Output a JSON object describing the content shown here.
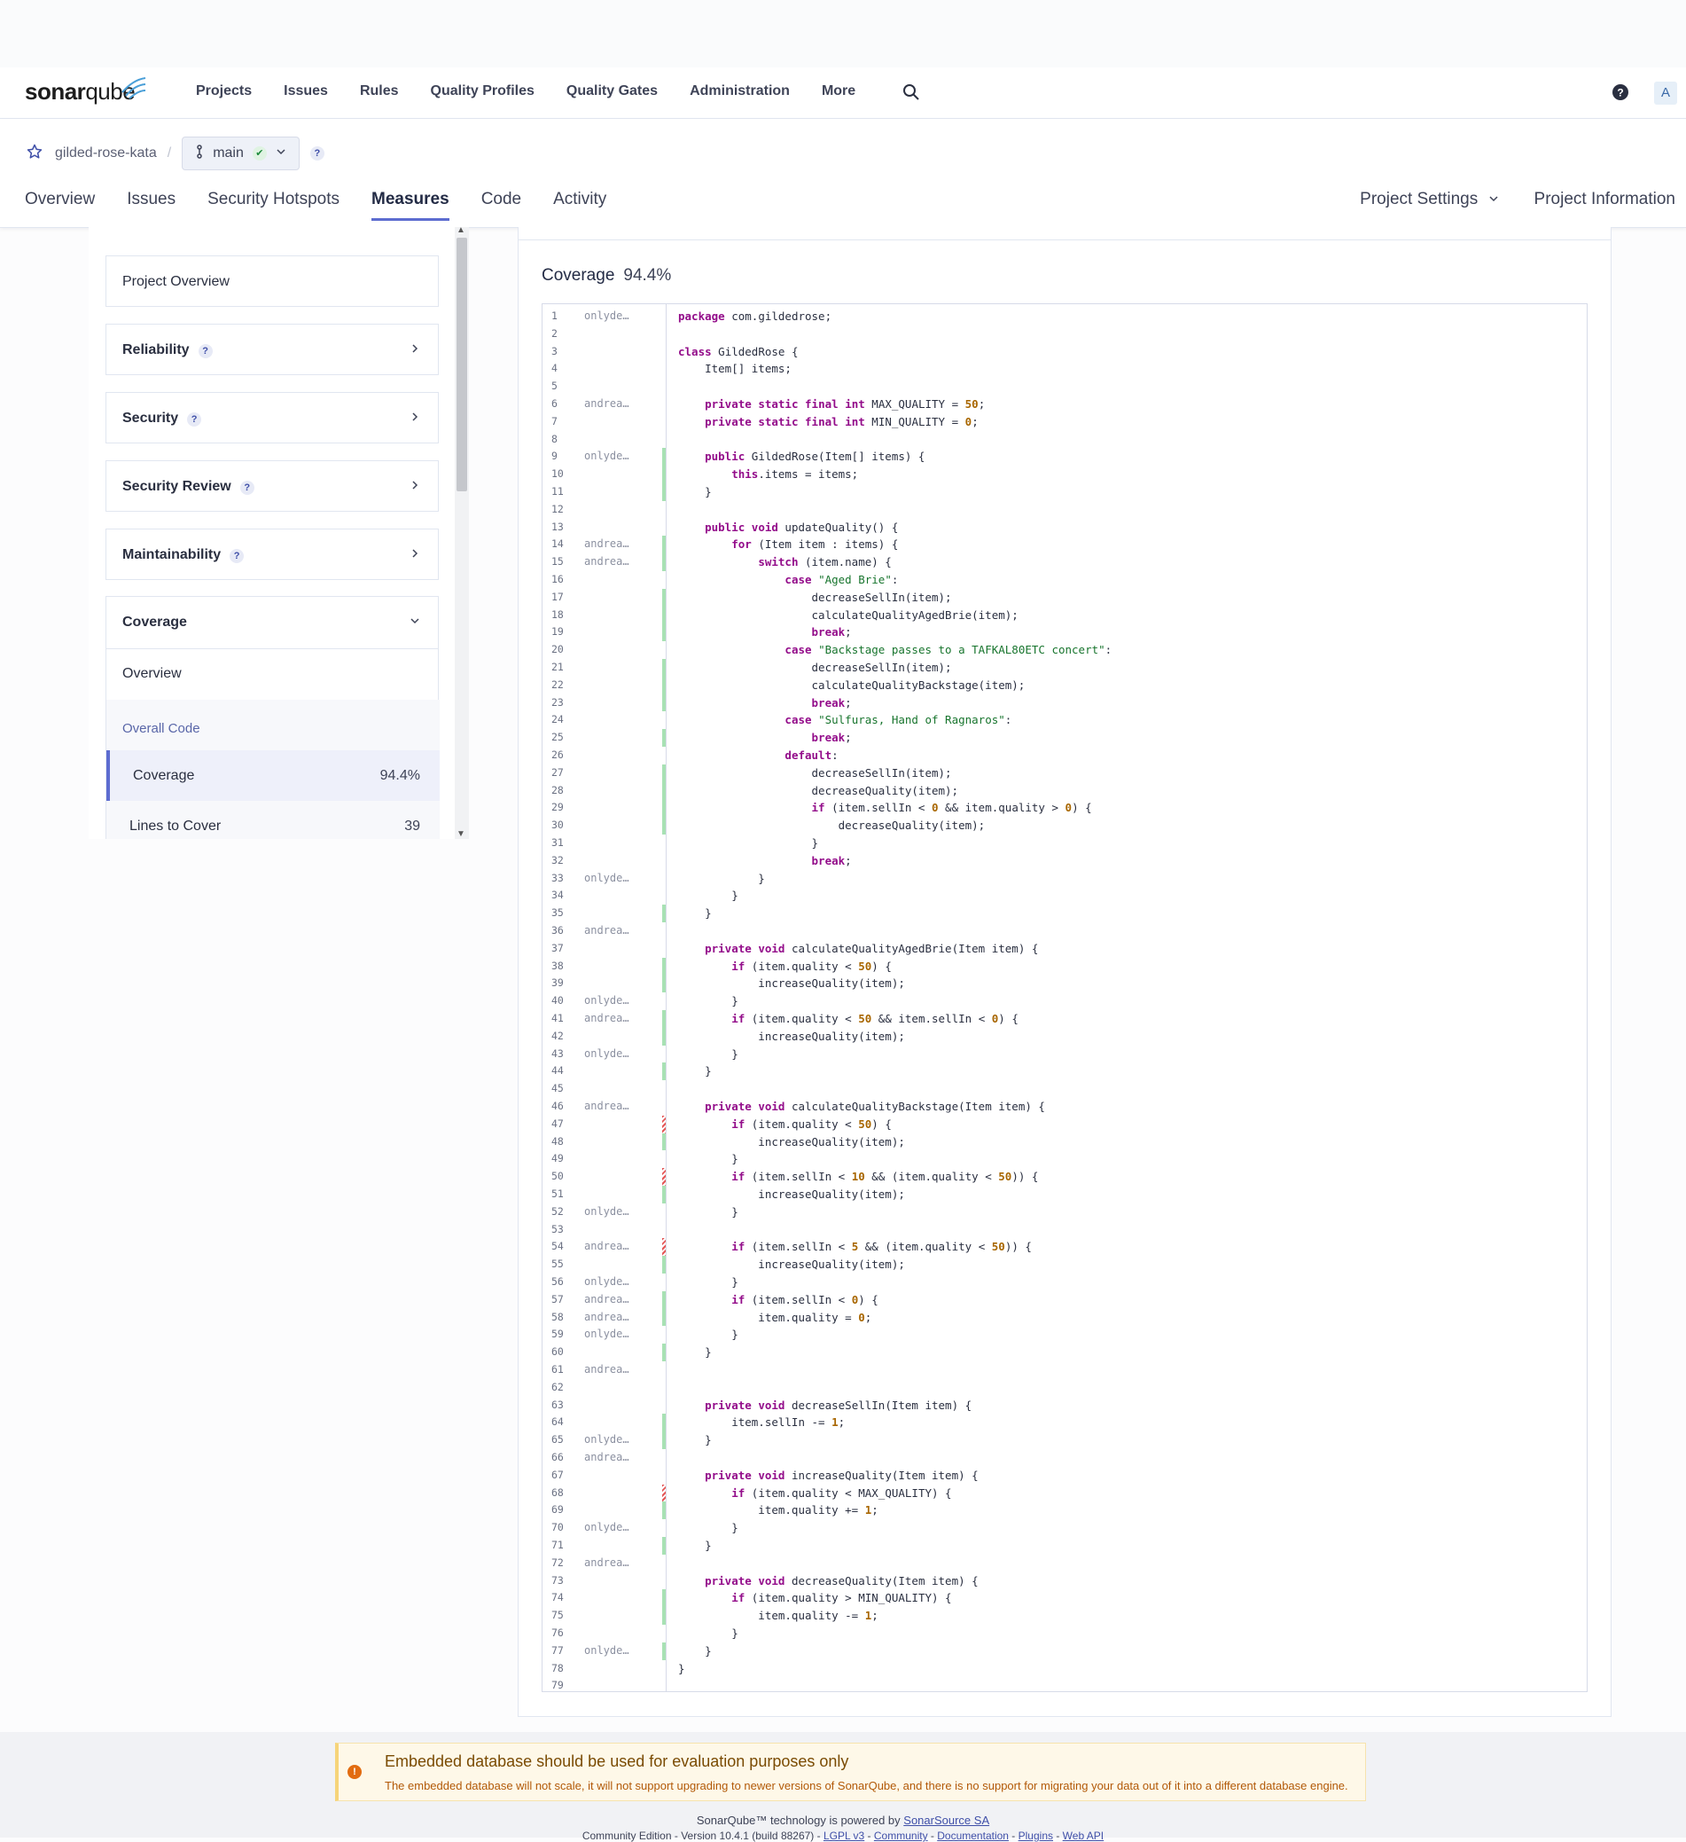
{
  "nav": {
    "logo_bold": "sonar",
    "logo_light": "qube",
    "links": [
      "Projects",
      "Issues",
      "Rules",
      "Quality Profiles",
      "Quality Gates",
      "Administration",
      "More"
    ],
    "avatar": "A"
  },
  "project": {
    "name": "gilded-rose-kata",
    "branch": "main",
    "tabs": [
      "Overview",
      "Issues",
      "Security Hotspots",
      "Measures",
      "Code",
      "Activity"
    ],
    "active_tab": "Measures",
    "settings": "Project Settings",
    "information": "Project Information"
  },
  "sidebar": {
    "project_overview": "Project Overview",
    "categories": [
      "Reliability",
      "Security",
      "Security Review",
      "Maintainability"
    ],
    "coverage": {
      "title": "Coverage",
      "overview": "Overview",
      "section": "Overall Code",
      "rows": [
        {
          "label": "Coverage",
          "value": "94.4%"
        },
        {
          "label": "Lines to Cover",
          "value": "39"
        }
      ]
    }
  },
  "main": {
    "title": "Coverage",
    "value": "94.4%"
  },
  "code": [
    {
      "n": 1,
      "a": "onlyde…",
      "c": "",
      "t": "package com.gildedrose;"
    },
    {
      "n": 2,
      "a": "",
      "c": "",
      "t": ""
    },
    {
      "n": 3,
      "a": "",
      "c": "",
      "t": "class GildedRose {"
    },
    {
      "n": 4,
      "a": "",
      "c": "",
      "t": "    Item[] items;"
    },
    {
      "n": 5,
      "a": "",
      "c": "",
      "t": ""
    },
    {
      "n": 6,
      "a": "andrea…",
      "c": "",
      "t": "    private static final int MAX_QUALITY = 50;"
    },
    {
      "n": 7,
      "a": "",
      "c": "",
      "t": "    private static final int MIN_QUALITY = 0;"
    },
    {
      "n": 8,
      "a": "",
      "c": "",
      "t": ""
    },
    {
      "n": 9,
      "a": "onlyde…",
      "c": "g",
      "t": "    public GildedRose(Item[] items) {"
    },
    {
      "n": 10,
      "a": "",
      "c": "g",
      "t": "        this.items = items;"
    },
    {
      "n": 11,
      "a": "",
      "c": "g",
      "t": "    }"
    },
    {
      "n": 12,
      "a": "",
      "c": "",
      "t": ""
    },
    {
      "n": 13,
      "a": "",
      "c": "",
      "t": "    public void updateQuality() {"
    },
    {
      "n": 14,
      "a": "andrea…",
      "c": "g",
      "t": "        for (Item item : items) {"
    },
    {
      "n": 15,
      "a": "andrea…",
      "c": "g",
      "t": "            switch (item.name) {"
    },
    {
      "n": 16,
      "a": "",
      "c": "",
      "t": "                case \"Aged Brie\":"
    },
    {
      "n": 17,
      "a": "",
      "c": "g",
      "t": "                    decreaseSellIn(item);"
    },
    {
      "n": 18,
      "a": "",
      "c": "g",
      "t": "                    calculateQualityAgedBrie(item);"
    },
    {
      "n": 19,
      "a": "",
      "c": "g",
      "t": "                    break;"
    },
    {
      "n": 20,
      "a": "",
      "c": "",
      "t": "                case \"Backstage passes to a TAFKAL80ETC concert\":"
    },
    {
      "n": 21,
      "a": "",
      "c": "g",
      "t": "                    decreaseSellIn(item);"
    },
    {
      "n": 22,
      "a": "",
      "c": "g",
      "t": "                    calculateQualityBackstage(item);"
    },
    {
      "n": 23,
      "a": "",
      "c": "g",
      "t": "                    break;"
    },
    {
      "n": 24,
      "a": "",
      "c": "",
      "t": "                case \"Sulfuras, Hand of Ragnaros\":"
    },
    {
      "n": 25,
      "a": "",
      "c": "g",
      "t": "                    break;"
    },
    {
      "n": 26,
      "a": "",
      "c": "",
      "t": "                default:"
    },
    {
      "n": 27,
      "a": "",
      "c": "g",
      "t": "                    decreaseSellIn(item);"
    },
    {
      "n": 28,
      "a": "",
      "c": "g",
      "t": "                    decreaseQuality(item);"
    },
    {
      "n": 29,
      "a": "",
      "c": "g",
      "t": "                    if (item.sellIn < 0 && item.quality > 0) {"
    },
    {
      "n": 30,
      "a": "",
      "c": "g",
      "t": "                        decreaseQuality(item);"
    },
    {
      "n": 31,
      "a": "",
      "c": "",
      "t": "                    }"
    },
    {
      "n": 32,
      "a": "",
      "c": "",
      "t": "                    break;"
    },
    {
      "n": 33,
      "a": "onlyde…",
      "c": "",
      "t": "            }"
    },
    {
      "n": 34,
      "a": "",
      "c": "",
      "t": "        }"
    },
    {
      "n": 35,
      "a": "",
      "c": "g",
      "t": "    }"
    },
    {
      "n": 36,
      "a": "andrea…",
      "c": "",
      "t": ""
    },
    {
      "n": 37,
      "a": "",
      "c": "",
      "t": "    private void calculateQualityAgedBrie(Item item) {"
    },
    {
      "n": 38,
      "a": "",
      "c": "g",
      "t": "        if (item.quality < 50) {"
    },
    {
      "n": 39,
      "a": "",
      "c": "g",
      "t": "            increaseQuality(item);"
    },
    {
      "n": 40,
      "a": "onlyde…",
      "c": "",
      "t": "        }"
    },
    {
      "n": 41,
      "a": "andrea…",
      "c": "g",
      "t": "        if (item.quality < 50 && item.sellIn < 0) {"
    },
    {
      "n": 42,
      "a": "",
      "c": "g",
      "t": "            increaseQuality(item);"
    },
    {
      "n": 43,
      "a": "onlyde…",
      "c": "",
      "t": "        }"
    },
    {
      "n": 44,
      "a": "",
      "c": "g",
      "t": "    }"
    },
    {
      "n": 45,
      "a": "",
      "c": "",
      "t": ""
    },
    {
      "n": 46,
      "a": "andrea…",
      "c": "",
      "t": "    private void calculateQualityBackstage(Item item) {"
    },
    {
      "n": 47,
      "a": "",
      "c": "p",
      "t": "        if (item.quality < 50) {"
    },
    {
      "n": 48,
      "a": "",
      "c": "g",
      "t": "            increaseQuality(item);"
    },
    {
      "n": 49,
      "a": "",
      "c": "",
      "t": "        }"
    },
    {
      "n": 50,
      "a": "",
      "c": "p",
      "t": "        if (item.sellIn < 10 && (item.quality < 50)) {"
    },
    {
      "n": 51,
      "a": "",
      "c": "g",
      "t": "            increaseQuality(item);"
    },
    {
      "n": 52,
      "a": "onlyde…",
      "c": "",
      "t": "        }"
    },
    {
      "n": 53,
      "a": "",
      "c": "",
      "t": ""
    },
    {
      "n": 54,
      "a": "andrea…",
      "c": "p",
      "t": "        if (item.sellIn < 5 && (item.quality < 50)) {"
    },
    {
      "n": 55,
      "a": "",
      "c": "g",
      "t": "            increaseQuality(item);"
    },
    {
      "n": 56,
      "a": "onlyde…",
      "c": "",
      "t": "        }"
    },
    {
      "n": 57,
      "a": "andrea…",
      "c": "g",
      "t": "        if (item.sellIn < 0) {"
    },
    {
      "n": 58,
      "a": "andrea…",
      "c": "g",
      "t": "            item.quality = 0;"
    },
    {
      "n": 59,
      "a": "onlyde…",
      "c": "",
      "t": "        }"
    },
    {
      "n": 60,
      "a": "",
      "c": "g",
      "t": "    }"
    },
    {
      "n": 61,
      "a": "andrea…",
      "c": "",
      "t": ""
    },
    {
      "n": 62,
      "a": "",
      "c": "",
      "t": ""
    },
    {
      "n": 63,
      "a": "",
      "c": "",
      "t": "    private void decreaseSellIn(Item item) {"
    },
    {
      "n": 64,
      "a": "",
      "c": "g",
      "t": "        item.sellIn -= 1;"
    },
    {
      "n": 65,
      "a": "onlyde…",
      "c": "g",
      "t": "    }"
    },
    {
      "n": 66,
      "a": "andrea…",
      "c": "",
      "t": ""
    },
    {
      "n": 67,
      "a": "",
      "c": "",
      "t": "    private void increaseQuality(Item item) {"
    },
    {
      "n": 68,
      "a": "",
      "c": "p",
      "t": "        if (item.quality < MAX_QUALITY) {"
    },
    {
      "n": 69,
      "a": "",
      "c": "g",
      "t": "            item.quality += 1;"
    },
    {
      "n": 70,
      "a": "onlyde…",
      "c": "",
      "t": "        }"
    },
    {
      "n": 71,
      "a": "",
      "c": "g",
      "t": "    }"
    },
    {
      "n": 72,
      "a": "andrea…",
      "c": "",
      "t": ""
    },
    {
      "n": 73,
      "a": "",
      "c": "",
      "t": "    private void decreaseQuality(Item item) {"
    },
    {
      "n": 74,
      "a": "",
      "c": "g",
      "t": "        if (item.quality > MIN_QUALITY) {"
    },
    {
      "n": 75,
      "a": "",
      "c": "g",
      "t": "            item.quality -= 1;"
    },
    {
      "n": 76,
      "a": "",
      "c": "",
      "t": "        }"
    },
    {
      "n": 77,
      "a": "onlyde…",
      "c": "g",
      "t": "    }"
    },
    {
      "n": 78,
      "a": "",
      "c": "",
      "t": "}"
    },
    {
      "n": 79,
      "a": "",
      "c": "",
      "t": ""
    }
  ],
  "footer": {
    "warning_title": "Embedded database should be used for evaluation purposes only",
    "warning_text": "The embedded database will not scale, it will not support upgrading to newer versions of SonarQube, and there is no support for migrating your data out of it into a different database engine.",
    "powered_prefix": "SonarQube™ technology is powered by ",
    "powered_link": "SonarSource SA",
    "edition": "Community Edition - Version 10.4.1 (build 88267) - ",
    "links": [
      "LGPL v3",
      "Community",
      "Documentation",
      "Plugins",
      "Web API"
    ]
  }
}
